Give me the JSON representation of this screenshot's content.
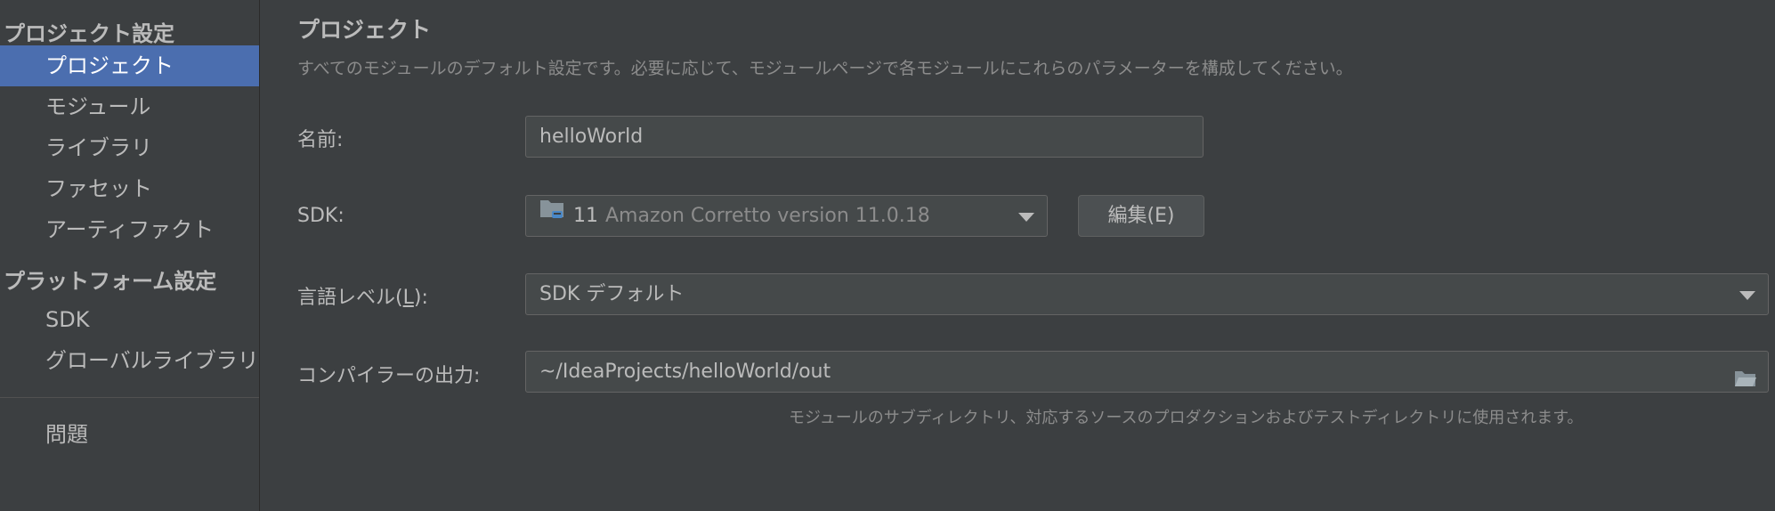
{
  "sidebar": {
    "project_settings_header": "プロジェクト設定",
    "project_items": [
      {
        "label": "プロジェクト",
        "selected": true
      },
      {
        "label": "モジュール",
        "selected": false
      },
      {
        "label": "ライブラリ",
        "selected": false
      },
      {
        "label": "ファセット",
        "selected": false
      },
      {
        "label": "アーティファクト",
        "selected": false
      }
    ],
    "platform_settings_header": "プラットフォーム設定",
    "platform_items": [
      {
        "label": "SDK"
      },
      {
        "label": "グローバルライブラリ"
      }
    ],
    "problems_label": "問題"
  },
  "main": {
    "title": "プロジェクト",
    "description": "すべてのモジュールのデフォルト設定です。必要に応じて、モジュールページで各モジュールにこれらのパラメーターを構成してください。",
    "name": {
      "label": "名前:",
      "value": "helloWorld"
    },
    "sdk": {
      "label": "SDK:",
      "version_number": "11",
      "version_text": "Amazon Corretto version 11.0.18",
      "edit_button_label": "編集(E)"
    },
    "language_level": {
      "label_prefix": "言語レベル(",
      "label_mnemonic": "L",
      "label_suffix": "):",
      "value": "SDK デフォルト"
    },
    "compiler_output": {
      "label": "コンパイラーの出力:",
      "value": "~/IdeaProjects/helloWorld/out",
      "hint": "モジュールのサブディレクトリ、対応するソースのプロダクションおよびテストディレクトリに使用されます。"
    }
  },
  "colors": {
    "background": "#3c3f41",
    "selection": "#4b6eaf",
    "field_background": "#45494a",
    "field_border": "#646464",
    "text": "#bbbbbb",
    "muted_text": "#8c8c8c"
  }
}
